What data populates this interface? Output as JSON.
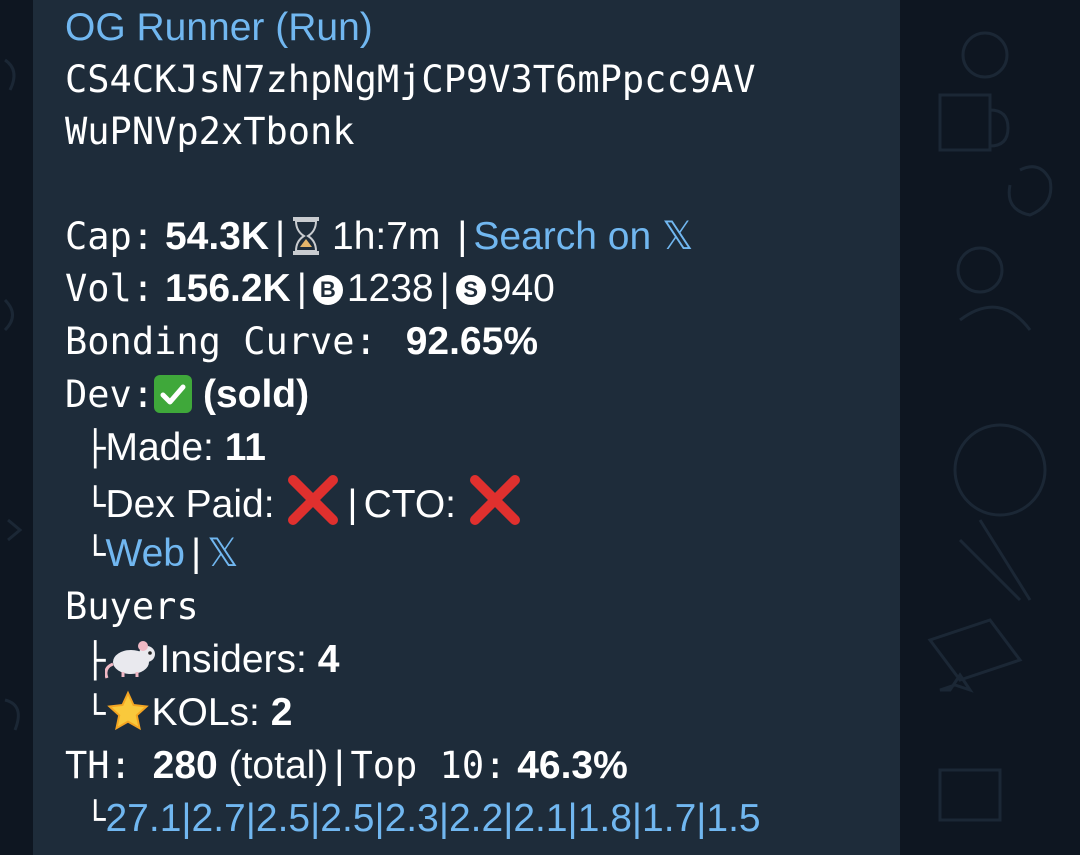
{
  "token": {
    "title": "OG Runner (Run)",
    "address_line1": "CS4CKJsN7zhpNgMjCP9V3T6mPpcc9AV",
    "address_line2": "WuPNVp2xTbonk"
  },
  "stats": {
    "cap_label": "Cap:",
    "cap_value": "54.3K",
    "age": "1h:7m",
    "search_link": "Search on 𝕏",
    "vol_label": "Vol:",
    "vol_value": "156.2K",
    "buys_icon_letter": "B",
    "buys": "1238",
    "sells_icon_letter": "S",
    "sells": "940",
    "bonding_label": "Bonding Curve:",
    "bonding_value": "92.65%"
  },
  "dev": {
    "label": "Dev:",
    "status": "(sold)",
    "made_label": "Made:",
    "made_value": "11",
    "dex_paid_label": "Dex Paid:",
    "cto_label": "CTO:",
    "web_link": "Web",
    "x_link": "𝕏"
  },
  "buyers": {
    "label": "Buyers",
    "insiders_label": "Insiders:",
    "insiders_value": "4",
    "kols_label": "KOLs:",
    "kols_value": "2"
  },
  "holders": {
    "th_label": "TH:",
    "th_value": "280",
    "th_suffix": "(total)",
    "top10_label": "Top 10:",
    "top10_value": "46.3%",
    "top_list": [
      "27.1",
      "2.7",
      "2.5",
      "2.5",
      "2.3",
      "2.2",
      "2.1",
      "1.8",
      "1.7",
      "1.5"
    ]
  },
  "icons": {
    "age": "hourglass-icon",
    "dev_status": "check-mark-icon",
    "dex_paid": "cross-mark-icon",
    "cto": "cross-mark-icon",
    "insiders": "rat-icon",
    "kols": "star-icon"
  },
  "colors": {
    "link": "#71b7f0",
    "bubble": "#1e2c3a",
    "background": "#0e1621",
    "check": "#3fa83a",
    "cross": "#e0302e"
  }
}
